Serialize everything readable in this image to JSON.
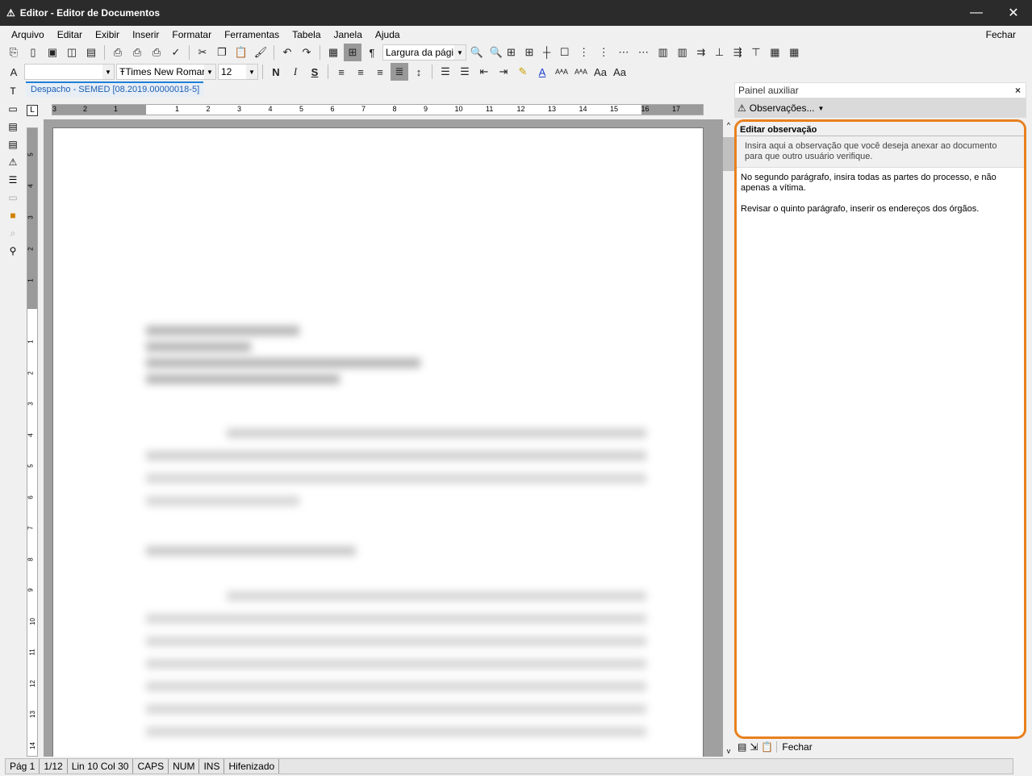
{
  "window": {
    "title": "Editor - Editor de Documentos",
    "minimize": "—",
    "close": "✕"
  },
  "menu": {
    "items": [
      "Arquivo",
      "Editar",
      "Exibir",
      "Inserir",
      "Formatar",
      "Ferramentas",
      "Tabela",
      "Janela",
      "Ajuda"
    ],
    "fechar": "Fechar"
  },
  "toolbar1": {
    "icons": [
      "new-from-template-icon",
      "new-document-icon",
      "open-icon",
      "open-recent-icon",
      "save-icon",
      "print-icon",
      "print-preview-icon",
      "print-setup-icon",
      "spellcheck-icon",
      "cut-icon",
      "copy-icon",
      "paste-icon",
      "format-painter-icon",
      "undo-icon",
      "redo-icon",
      "table-icon",
      "grid-icon",
      "pilcrow-icon"
    ],
    "zoom_value": "Largura da págir"
  },
  "toolbar2": {
    "style_value": "",
    "font_value": "Times New Romar",
    "size_value": "12",
    "bold": "N",
    "italic": "I",
    "strike": "S"
  },
  "doc_tab": "Despacho -  SEMED [08.2019.00000018-5]",
  "ruler": {
    "left": [
      "3",
      "2",
      "1"
    ],
    "right": [
      "1",
      "2",
      "3",
      "4",
      "5",
      "6",
      "7",
      "8",
      "9",
      "10",
      "11",
      "12",
      "13",
      "14",
      "15",
      "16",
      "17"
    ]
  },
  "vruler": {
    "top": [
      "5",
      "4",
      "3",
      "2",
      "1"
    ],
    "bottom": [
      "1",
      "2",
      "3",
      "4",
      "5",
      "6",
      "7",
      "8",
      "9",
      "10",
      "11",
      "12",
      "13",
      "14"
    ]
  },
  "panel": {
    "title": "Painel auxiliar",
    "close": "×",
    "dropdown": "Observações...",
    "edit_title": "Editar observação",
    "hint": "Insira aqui a observação que você deseja anexar ao documento para que outro usuário verifique.",
    "note": "No segundo parágrafo, insira todas as partes do processo, e não apenas a vítima.\n\nRevisar o quinto parágrafo, inserir os endereços dos órgãos.",
    "footer_close": "Fechar",
    "highlight_color": "#e8801e"
  },
  "status": {
    "page": "Pág 1",
    "pages": "1/12",
    "position": "Lin 10  Col 30",
    "caps": "CAPS",
    "num": "NUM",
    "ins": "INS",
    "hyphen": "Hifenizado"
  }
}
